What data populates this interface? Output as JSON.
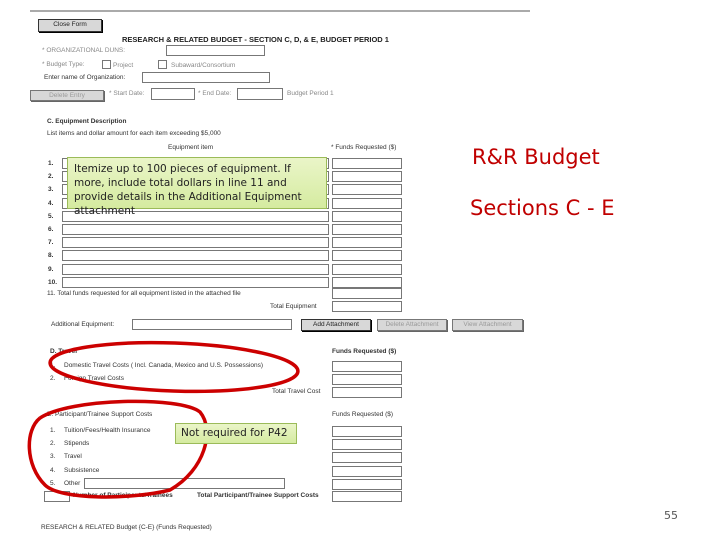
{
  "form": {
    "close_button": "Close Form",
    "title": "RESEARCH & RELATED BUDGET - SECTION C, D, & E, BUDGET PERIOD  1",
    "duns_label": "* ORGANIZATIONAL DUNS:",
    "budget_type_label": "* Budget Type:",
    "budget_type_options": [
      "Project",
      "Subaward/Consortium"
    ],
    "org_name_label": "Enter name of Organization:",
    "delete_entry": "Delete Entry",
    "start_date_label": "* Start Date:",
    "end_date_label": "* End Date:",
    "budget_period": "Budget Period 1",
    "equipment": {
      "heading": "C. Equipment Description",
      "instructions": "List items and dollar amount for each item exceeding $5,000",
      "col_item": "Equipment item",
      "col_funds": "* Funds Requested ($)",
      "row_numbers": [
        "1.",
        "2.",
        "3.",
        "4.",
        "5.",
        "6.",
        "7.",
        "8.",
        "9.",
        "10."
      ],
      "line11": "11.  Total funds requested for all equipment listed in the attached file",
      "total_label": "Total Equipment",
      "additional_label": "Additional Equipment:",
      "add_attachment": "Add Attachment",
      "delete_attachment": "Delete Attachment",
      "view_attachment": "View Attachment"
    },
    "travel": {
      "heading": "D. Travel",
      "col_funds": "Funds Requested ($)",
      "rows": [
        {
          "num": "1.",
          "label": "Domestic Travel Costs ( Incl. Canada, Mexico and U.S. Possessions)"
        },
        {
          "num": "2.",
          "label": "Foreign Travel Costs"
        }
      ],
      "total_label": "Total Travel Cost"
    },
    "participant": {
      "heading": "E. Participant/Trainee Support Costs",
      "col_funds": "Funds Requested ($)",
      "rows": [
        {
          "num": "1.",
          "label": "Tuition/Fees/Health Insurance"
        },
        {
          "num": "2.",
          "label": "Stipends"
        },
        {
          "num": "3.",
          "label": "Travel"
        },
        {
          "num": "4.",
          "label": "Subsistence"
        },
        {
          "num": "5.",
          "label": "Other"
        }
      ],
      "count_label": "Number of Participants/Trainees",
      "total_label": "Total Participant/Trainee Support Costs"
    },
    "footer": "RESEARCH & RELATED Budget {C-E} (Funds Requested)"
  },
  "callouts": {
    "equipment": "Itemize up to 100 pieces of equipment. If more, include total dollars in line 11 and provide details in the Additional Equipment attachment",
    "participant": "Not required for P42"
  },
  "slide": {
    "title_line1": "R&R Budget",
    "title_line2": "Sections C - E",
    "page_number": "55",
    "accent": "#c00000",
    "highlight_ring": "#cc0000"
  }
}
